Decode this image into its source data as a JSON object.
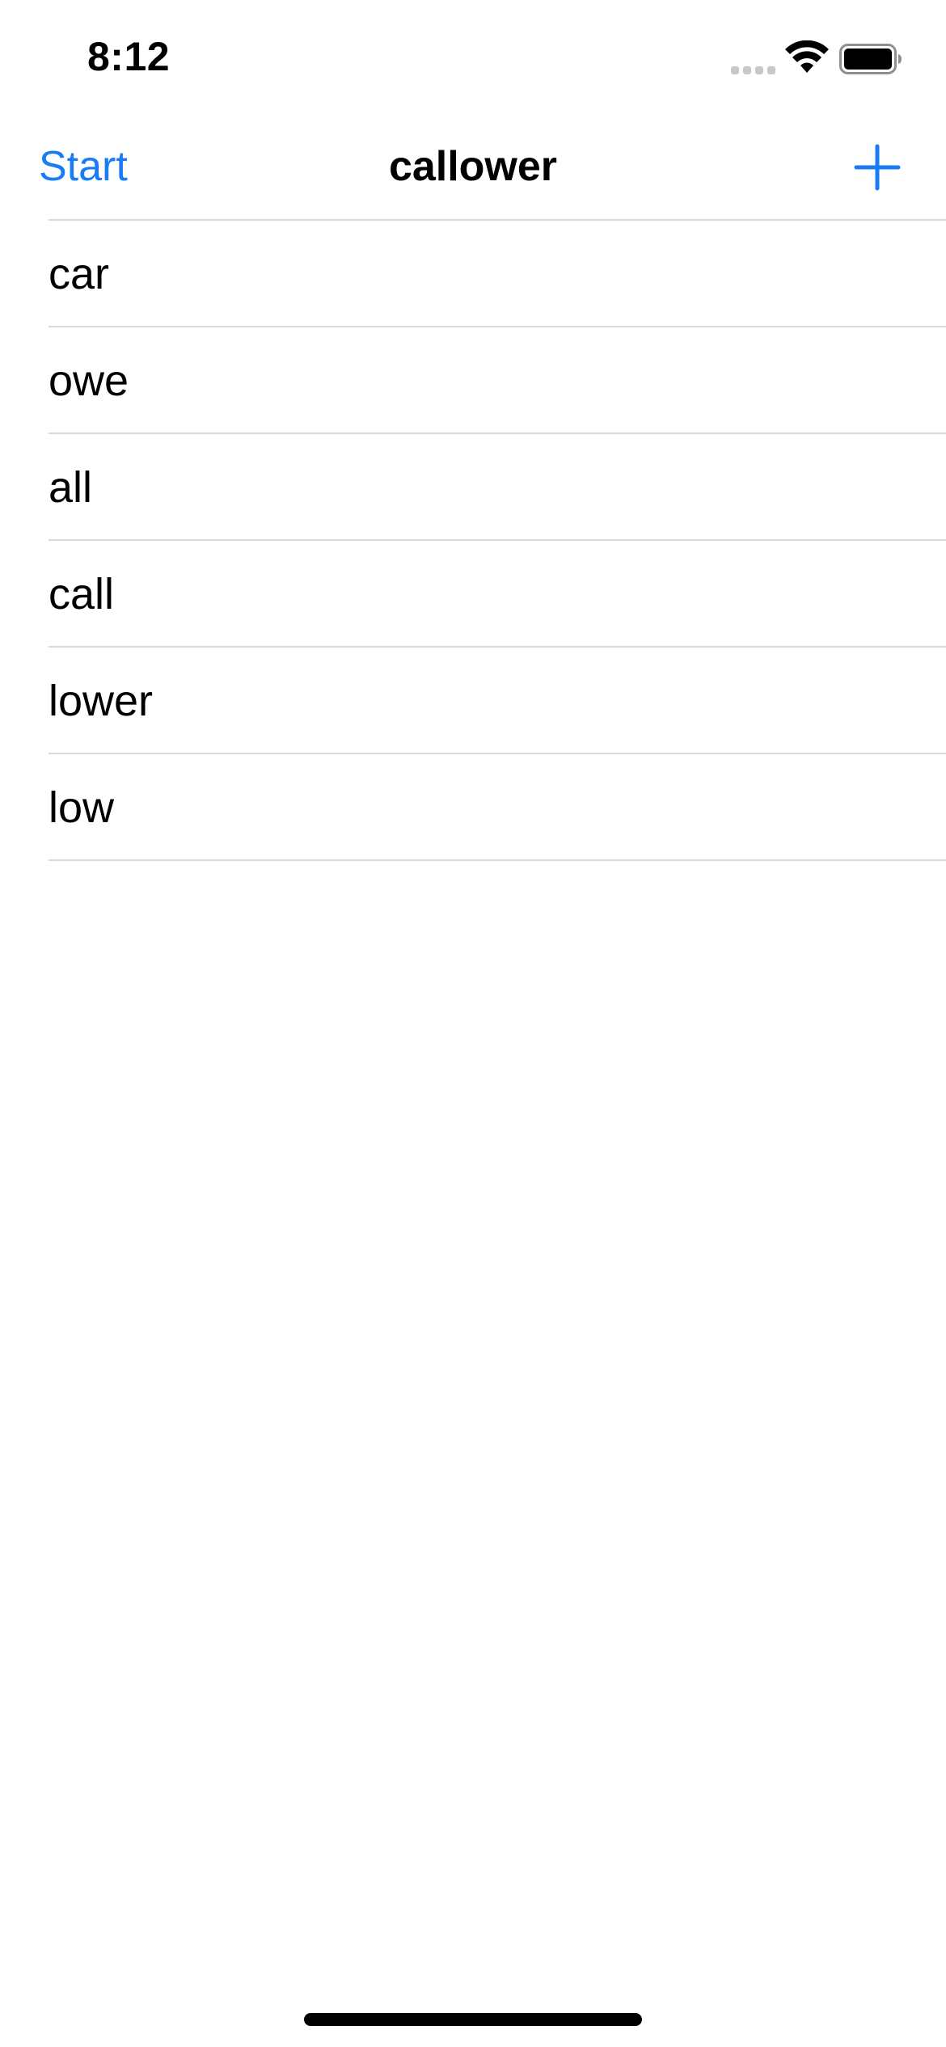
{
  "status_bar": {
    "time": "8:12"
  },
  "nav": {
    "left_button": "Start",
    "title": "callower",
    "right_icon": "plus-icon"
  },
  "words": [
    {
      "label": "car"
    },
    {
      "label": "owe"
    },
    {
      "label": "all"
    },
    {
      "label": "call"
    },
    {
      "label": "lower"
    },
    {
      "label": "low"
    }
  ],
  "colors": {
    "accent": "#1a7cf5",
    "separator": "#d9d9dc",
    "text": "#000000",
    "background": "#ffffff"
  }
}
